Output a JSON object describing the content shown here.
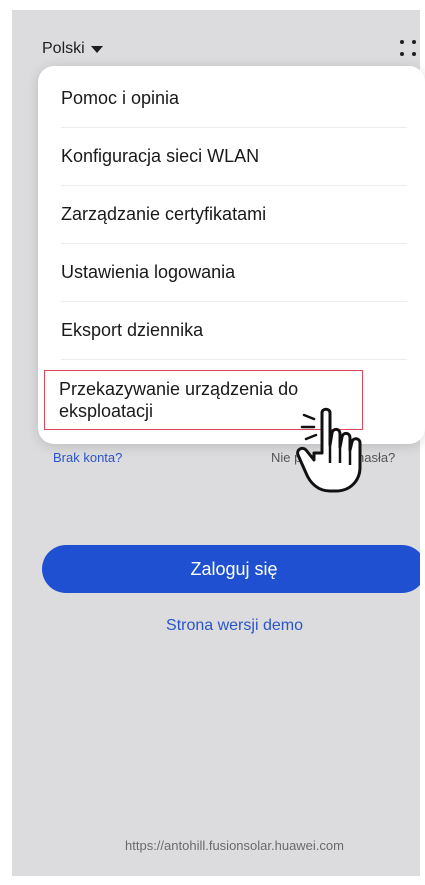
{
  "header": {
    "language_label": "Polski",
    "more_icon": "grid-dots-icon"
  },
  "popup_menu": {
    "items": [
      {
        "label": "Pomoc i opinia"
      },
      {
        "label": "Konfiguracja sieci WLAN"
      },
      {
        "label": "Zarządzanie certyfikatami"
      },
      {
        "label": "Ustawienia logowania"
      },
      {
        "label": "Eksport dziennika"
      },
      {
        "label_line1": "Przekazywanie urządzenia do",
        "label_line2": "eksploatacji",
        "highlighted": true
      }
    ]
  },
  "login": {
    "no_account_link": "Brak konta?",
    "forgot_password_link": "Nie pamiętasz hasła?",
    "login_button": "Zaloguj się",
    "demo_link": "Strona wersji demo"
  },
  "footer": {
    "url": "https://antohill.fusionsolar.huawei.com"
  },
  "colors": {
    "accent": "#1f50d2",
    "highlight_border": "#e0465a"
  }
}
